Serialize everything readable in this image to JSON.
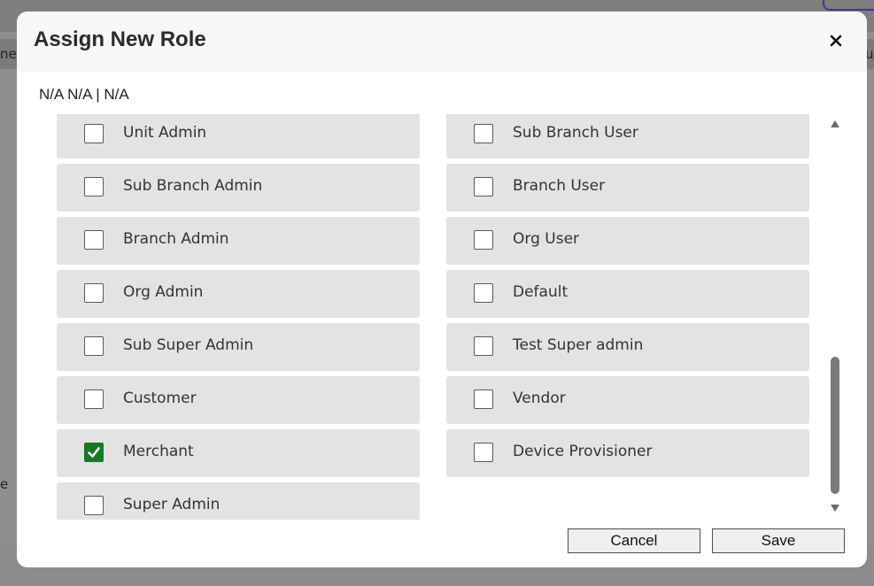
{
  "background": {
    "partial_header_left": "ne",
    "partial_header_right": "us",
    "partial_label_left": "e"
  },
  "modal": {
    "title": "Assign New Role",
    "close_glyph": "×",
    "subtitle": "N/A N/A | N/A",
    "roles_left": [
      {
        "label": "Unit Admin",
        "checked": false
      },
      {
        "label": "Sub Branch Admin",
        "checked": false
      },
      {
        "label": "Branch Admin",
        "checked": false
      },
      {
        "label": "Org Admin",
        "checked": false
      },
      {
        "label": "Sub Super Admin",
        "checked": false
      },
      {
        "label": "Customer",
        "checked": false
      },
      {
        "label": "Merchant",
        "checked": true
      },
      {
        "label": "Super Admin",
        "checked": false
      }
    ],
    "roles_right": [
      {
        "label": "Sub Branch User",
        "checked": false
      },
      {
        "label": "Branch User",
        "checked": false
      },
      {
        "label": "Org User",
        "checked": false
      },
      {
        "label": "Default",
        "checked": false
      },
      {
        "label": "Test Super admin",
        "checked": false
      },
      {
        "label": "Vendor",
        "checked": false
      },
      {
        "label": "Device Provisioner",
        "checked": false
      }
    ],
    "cancel_label": "Cancel",
    "save_label": "Save"
  },
  "colors": {
    "checked": "#157a23",
    "item_bg": "#e3e3e3",
    "overlay": "#8c8c8c"
  },
  "icons": {
    "close": "close-icon",
    "check": "checkmark-icon",
    "scroll_up": "scroll-up-arrow-icon",
    "scroll_down": "scroll-down-arrow-icon"
  }
}
